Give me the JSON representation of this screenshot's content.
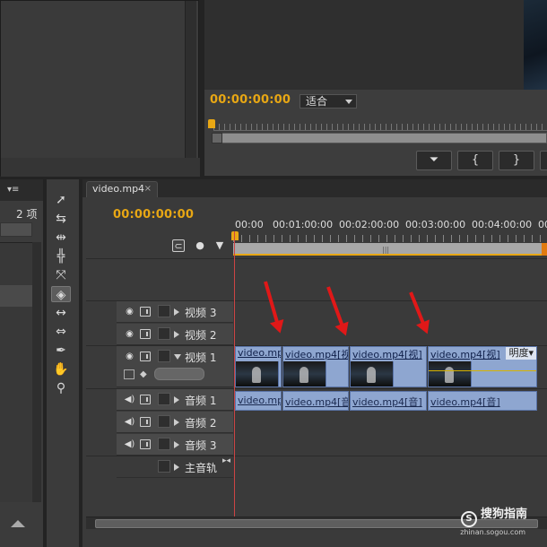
{
  "monitor": {
    "timecode": "00:00:00:00",
    "fit_select": "适合",
    "buttons": [
      "⏷",
      "{",
      "}"
    ]
  },
  "project": {
    "item_count": "2 项"
  },
  "timeline": {
    "tab_title": "video.mp4",
    "tab_close": "×",
    "sequence_timecode": "00:00:00:00",
    "ruler_labels": [
      "00:00",
      "00:01:00:00",
      "00:02:00:00",
      "00:03:00:00",
      "00:04:00:00",
      "00"
    ],
    "tracks": {
      "video3": "视频 3",
      "video2": "视频 2",
      "video1": "视频 1",
      "audio1": "音频 1",
      "audio2": "音频 2",
      "audio3": "音频 3",
      "master": "主音轨"
    },
    "video_clips": [
      "video.mp",
      "video.mp4[视",
      "video.mp4[视]",
      "video.mp4[视]"
    ],
    "video_clip_dropdown": "明度",
    "audio_clips": [
      "video.mp",
      "video.mp4[音",
      "video.mp4[音]",
      "video.mp4[音]"
    ]
  },
  "watermark": {
    "brand": "搜狗指南",
    "url": "zhinan.sogou.com"
  },
  "icons": {
    "tools": [
      "selection-tool-icon",
      "track-select-icon",
      "ripple-edit-icon",
      "rolling-edit-icon",
      "rate-stretch-icon",
      "razor-icon",
      "slip-icon",
      "slide-icon",
      "pen-icon",
      "hand-icon",
      "zoom-icon"
    ]
  },
  "colors": {
    "timecode": "#e8a714",
    "clip": "#8ea6d0",
    "annotation_arrow": "#e01818"
  }
}
